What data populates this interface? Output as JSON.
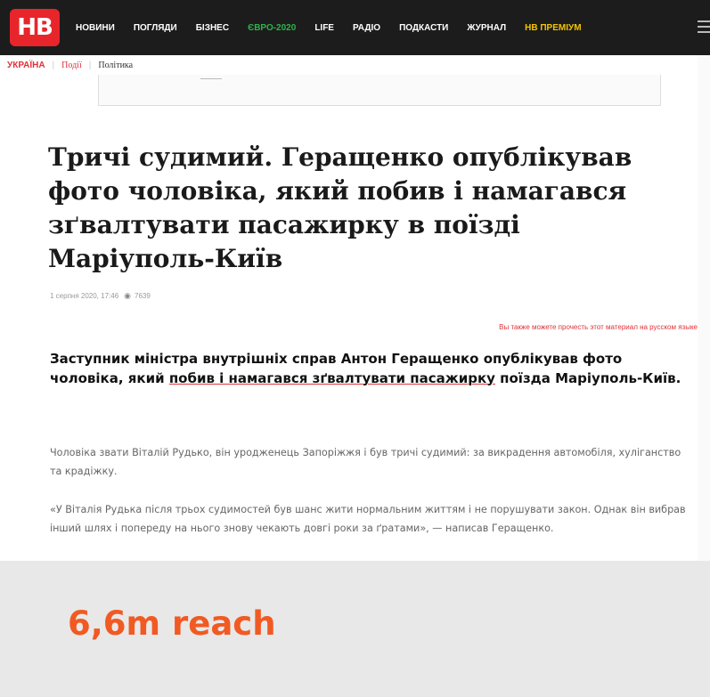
{
  "header": {
    "logo_text": "НВ",
    "nav": [
      {
        "label": "НОВИНИ",
        "style": "normal"
      },
      {
        "label": "ПОГЛЯДИ",
        "style": "normal"
      },
      {
        "label": "БІЗНЕС",
        "style": "normal"
      },
      {
        "label": "ЄВРО-2020",
        "style": "euro"
      },
      {
        "label": "LIFE",
        "style": "normal"
      },
      {
        "label": "РАДІО",
        "style": "normal"
      },
      {
        "label": "ПОДКАСТИ",
        "style": "normal"
      },
      {
        "label": "ЖУРНАЛ",
        "style": "normal"
      },
      {
        "label": "НВ ПРЕМІУМ",
        "style": "premium"
      }
    ]
  },
  "breadcrumb": {
    "section": "УКРАЇНА",
    "category": "Події",
    "subcategory": "Політика"
  },
  "article": {
    "title": "Тричі судимий. Геращенко опублікував фото чоловіка, який побив і намагався зґвалтувати пасажирку в поїзді Маріуполь-Київ",
    "date": "1 серпня 2020, 17:46",
    "views": "7639",
    "russian_link": "Вы также можете прочесть этот материал на русском языке",
    "lead_before": "Заступник міністра внутрішніх справ Антон Геращенко опублікував фото чоловіка, який ",
    "lead_link": "побив і намагався зґвалтувати пасажирку",
    "lead_after": " поїзда Маріуполь-Київ.",
    "paragraph1": "Чоловіка звати Віталій Рудько, він уродженець Запоріжжя і був тричі судимий: за викрадення автомобіля, хуліганство та крадіжку.",
    "paragraph2": "«У Віталія Рудька після трьох судимостей був шанс жити нормальним життям і не порушувати закон. Однак він вибрав інший шлях і попереду на нього знову чекають довгі роки за ґратами», — написав Геращенко."
  },
  "reach": "6,6m reach",
  "colors": {
    "brand_red": "#e8252b",
    "euro_green": "#2fb24a",
    "premium_yellow": "#f5c400",
    "reach_orange": "#f15a22"
  },
  "icons": {
    "views": "eye-icon",
    "menu": "hamburger-menu-icon"
  }
}
